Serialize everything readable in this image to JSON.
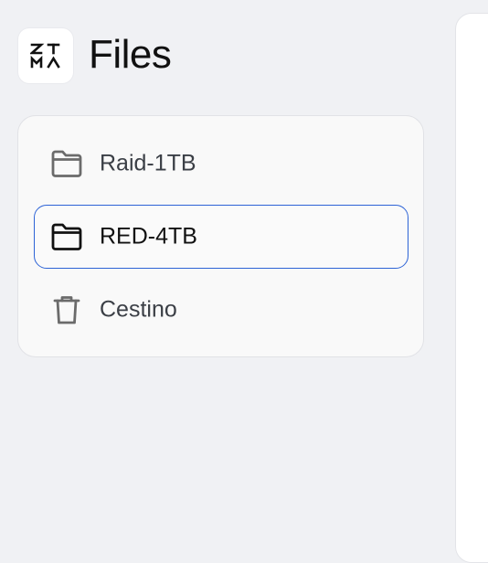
{
  "app": {
    "logo_text": "ZIMA",
    "title": "Files"
  },
  "sidebar": {
    "items": [
      {
        "label": "Raid-1TB",
        "icon": "folder-icon",
        "active": false
      },
      {
        "label": "RED-4TB",
        "icon": "folder-icon",
        "active": true
      },
      {
        "label": "Cestino",
        "icon": "trash-icon",
        "active": false
      }
    ]
  },
  "colors": {
    "background": "#f0f1f4",
    "panel": "#f9f9f9",
    "active_border": "#2d63d6",
    "icon_muted": "#6b6b6b",
    "icon_active": "#111111",
    "text": "#3b3f46"
  }
}
